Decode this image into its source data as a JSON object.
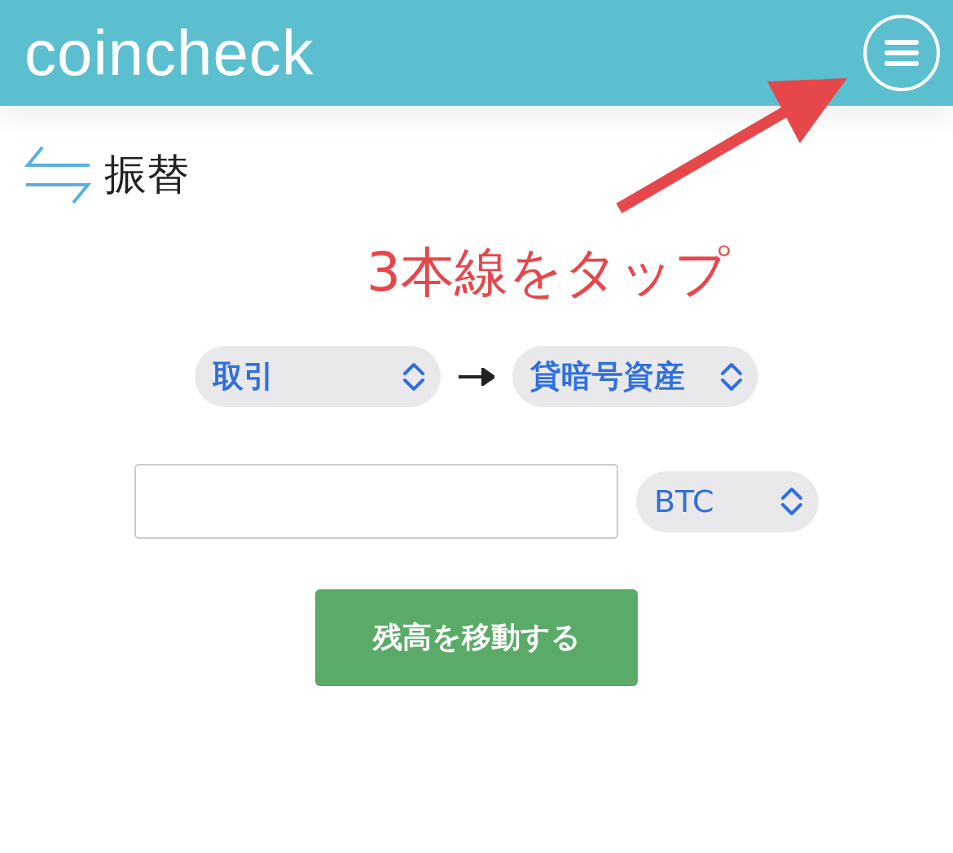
{
  "header": {
    "logo": "coincheck"
  },
  "page": {
    "title": "振替"
  },
  "annotation": {
    "text": "3本線をタップ"
  },
  "transfer": {
    "from": {
      "value": "取引"
    },
    "to": {
      "value": "貸暗号資産"
    },
    "currency": {
      "value": "BTC"
    },
    "submit": "残高を移動する"
  }
}
